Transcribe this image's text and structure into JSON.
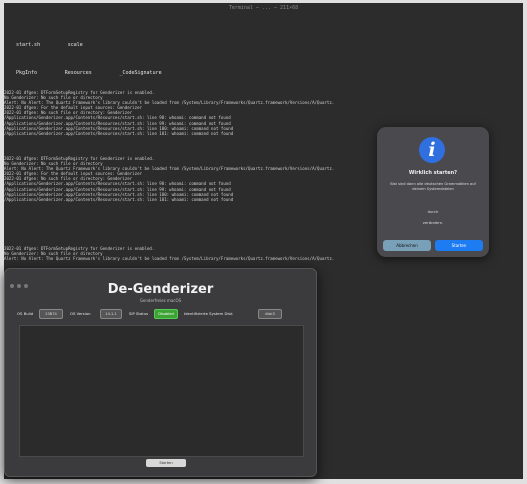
{
  "terminal": {
    "title": "Terminal — ... — 211×68",
    "files_row1": [
      "start.sh",
      "scale"
    ],
    "files_row2": [
      "PkgInfo",
      "Resources",
      "_CodeSignature"
    ],
    "log_block1": [
      "2022-01 dfgen: DTFormSetupRegistry for Genderizer is enabled.",
      "No Genderizer: No such file or directory",
      "Alert: No Alert: The Quartz Framework's library couldn't be loaded from /System/Library/Frameworks/Quartz.framework/Versions/A/Quartz.",
      "2022-01 dfgen: For the default input sources: Genderizer",
      "2022-01 dfgen: No such file or directory: Genderizer",
      "/Applications/Genderizer.app/Contents/Resources/start.sh: line 98: whoami: command not found",
      "/Applications/Genderizer.app/Contents/Resources/start.sh: line 99: whoami: command not found",
      "/Applications/Genderizer.app/Contents/Resources/start.sh: line 100: whoami: command not found",
      "/Applications/Genderizer.app/Contents/Resources/start.sh: line 101: whoami: command not found"
    ],
    "log_block2": [
      "2022-01 dfgen: DTFormSetupRegistry for Genderizer is enabled.",
      "No Genderizer: No such file or directory",
      "Alert: No Alert: The Quartz Framework's library couldn't be loaded from /System/Library/Frameworks/Quartz.framework/Versions/A/Quartz.",
      "2022-01 dfgen: For the default input sources: Genderizer",
      "2022-01 dfgen: No such file or directory: Genderizer",
      "/Applications/Genderizer.app/Contents/Resources/start.sh: line 98: whoami: command not found",
      "/Applications/Genderizer.app/Contents/Resources/start.sh: line 99: whoami: command not found",
      "/Applications/Genderizer.app/Contents/Resources/start.sh: line 100: whoami: command not found",
      "/Applications/Genderizer.app/Contents/Resources/start.sh: line 101: whoami: command not found"
    ],
    "log_block3": [
      "2022-01 dfgen: DTFormSetupRegistry for Genderizer is enabled.",
      "No Genderizer: No such file or directory",
      "Alert: No Alert: The Quartz Framework's library couldn't be loaded from /System/Library/Frameworks/Quartz.framework/Versions/A/Quartz."
    ]
  },
  "dialog": {
    "title": "Wirklich starten?",
    "message": "Bist sind dann alle deutschen Grammatiken auf deinem Systemdateien",
    "line2": "durch",
    "line3": "verändern.",
    "cancel_label": "Abbrechen",
    "ok_label": "Starten",
    "icon": "info-icon"
  },
  "app": {
    "title": "De-Genderizer",
    "subtitle": "Genderfreies macOS",
    "stats": {
      "os_build_label": "OS Build",
      "os_build_value": "23B74",
      "os_version_label": "OS Version",
      "os_version_value": "14.1.1",
      "sip_label": "SIP Status",
      "sip_value": "Disabled",
      "identifier_label": "Identifizierte System Disk",
      "identifier_value": "disk3"
    },
    "bottom_button_label": "Starten",
    "accent_green": "#3da334"
  }
}
